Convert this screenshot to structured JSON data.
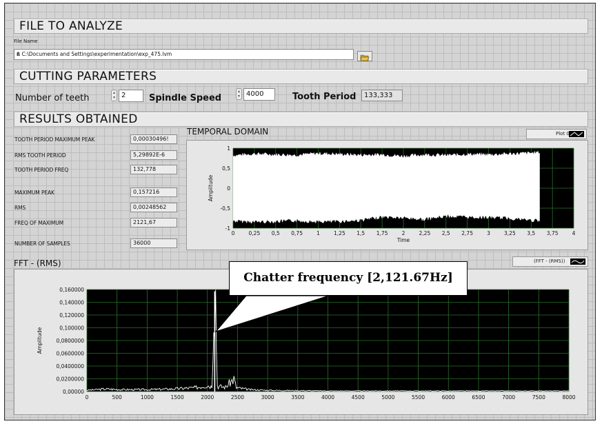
{
  "sections": {
    "file": "FILE TO ANALYZE",
    "cutting": "CUTTING PARAMETERS",
    "results": "RESULTS OBTAINED"
  },
  "file": {
    "label": "File Name",
    "path": "C:\\Documents and Settings\\experimentation\\exp_475.lvm",
    "folder_icon": "folder-open-icon"
  },
  "cutting": {
    "teeth_label": "Number of teeth",
    "teeth_value": "2",
    "speed_label": "Spindle Speed",
    "speed_value": "4000",
    "tooth_period_label": "Tooth Period",
    "tooth_period_value": "133,333"
  },
  "results": [
    {
      "label": "TOOTH PERIOD MAXIMUM PEAK",
      "value": "0,00030496!"
    },
    {
      "label": "RMS TOOTH PERIOD",
      "value": "5,29892E-6"
    },
    {
      "label": "TOOTH PERIOD FREQ",
      "value": "132,778"
    },
    {
      "label": "MAXIMUM PEAK",
      "value": "0,157216"
    },
    {
      "label": "RMS",
      "value": "0,00248562"
    },
    {
      "label": "FREQ OF MAXIMUM",
      "value": "2121,67"
    },
    {
      "label": "NUMBER OF SAMPLES",
      "value": "36000"
    }
  ],
  "temporal": {
    "title": "TEMPORAL DOMAIN",
    "legend": "Plot 0"
  },
  "fft": {
    "title": "FFT - (RMS)",
    "legend": "(FFT - (RMS))"
  },
  "callout": "Chatter frequency [2,121.67Hz]",
  "colors": {
    "plot_bg": "#000000",
    "grid": "#2d6f2d",
    "signal": "#ffffff"
  },
  "chart_data": [
    {
      "type": "area",
      "name": "temporal",
      "xlabel": "Time",
      "ylabel": "Amplitude",
      "xlim": [
        0,
        4
      ],
      "ylim": [
        -1,
        1
      ],
      "x_ticks": [
        "0",
        "0,25",
        "0,5",
        "0,75",
        "1",
        "1,25",
        "1,5",
        "1,75",
        "2",
        "2,25",
        "2,5",
        "2,75",
        "3",
        "3,25",
        "3,5",
        "3,75",
        "4"
      ],
      "y_ticks": [
        "1",
        "0,5",
        "0",
        "-0,5",
        "-1"
      ],
      "signal_end_x": 3.6,
      "envelope_x": [
        0,
        0.25,
        0.5,
        0.75,
        1,
        1.25,
        1.5,
        1.75,
        2,
        2.25,
        2.5,
        2.75,
        3,
        3.25,
        3.5,
        3.6
      ],
      "envelope_upper": [
        0.82,
        0.86,
        0.84,
        0.83,
        0.87,
        0.85,
        0.83,
        0.84,
        0.8,
        0.84,
        0.82,
        0.85,
        0.84,
        0.86,
        0.88,
        0.9
      ],
      "envelope_lower": [
        -0.82,
        -0.84,
        -0.83,
        -0.81,
        -0.84,
        -0.83,
        -0.8,
        -0.72,
        -0.74,
        -0.78,
        -0.7,
        -0.72,
        -0.73,
        -0.75,
        -0.8,
        -0.82
      ],
      "grid": true
    },
    {
      "type": "line",
      "name": "fft",
      "xlabel": "",
      "ylabel": "Amplitude",
      "xlim": [
        0,
        8000
      ],
      "ylim": [
        0,
        0.16
      ],
      "x_ticks": [
        "0",
        "500",
        "1000",
        "1500",
        "2000",
        "2500",
        "3000",
        "3500",
        "4000",
        "4500",
        "5000",
        "5500",
        "6000",
        "6500",
        "7000",
        "7500",
        "8000"
      ],
      "y_ticks": [
        "0,160000",
        "0,140000",
        "0,120000",
        "0,100000",
        "0,0800000",
        "0,0600000",
        "0,0400000",
        "0,0200000",
        "0,00000"
      ],
      "x": [
        0,
        300,
        600,
        1000,
        1400,
        1800,
        2000,
        2060,
        2121.67,
        2180,
        2300,
        2440,
        2480,
        2700,
        3000,
        4000,
        5000,
        6000,
        7000,
        8000
      ],
      "y": [
        0.002,
        0.004,
        0.003,
        0.003,
        0.004,
        0.006,
        0.01,
        0.008,
        0.157216,
        0.008,
        0.007,
        0.02,
        0.006,
        0.003,
        0.002,
        0.001,
        0.001,
        0.001,
        0.001,
        0.001
      ],
      "grid": true
    }
  ]
}
